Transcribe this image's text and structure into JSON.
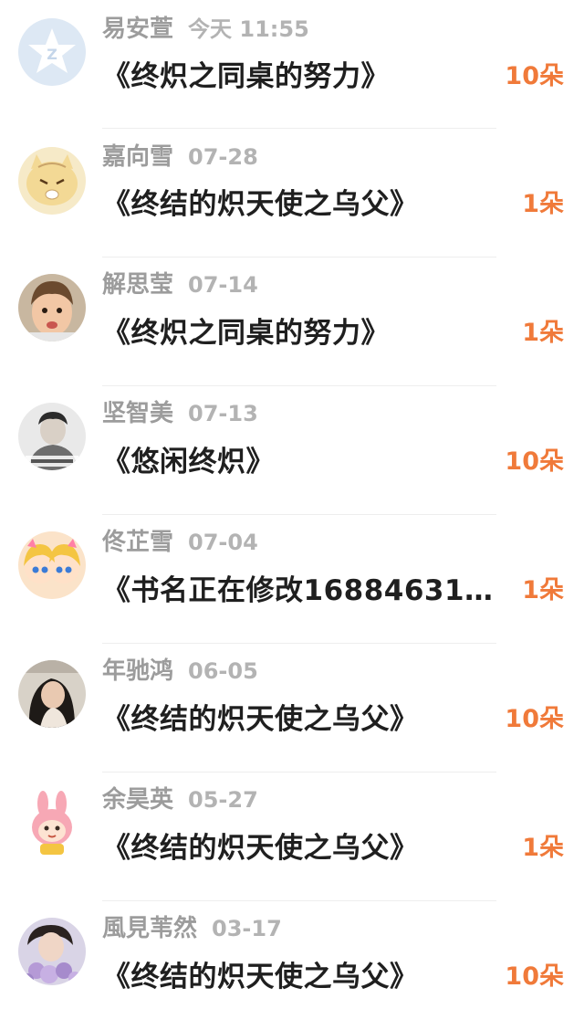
{
  "colors": {
    "count_accent": "#f07a3a",
    "name_gray": "#9c9c9c",
    "title_dark": "#1f1f1f"
  },
  "gifts": [
    {
      "name": "易安萱",
      "date": "今天 11:55",
      "title": "《终炽之同桌的努力》",
      "count": "10朵",
      "avatar": "default-star-avatar"
    },
    {
      "name": "嘉向雪",
      "date": "07-28",
      "title": "《终结的炽天使之乌父》",
      "count": "1朵",
      "avatar": "cartoon-cat-avatar"
    },
    {
      "name": "解思莹",
      "date": "07-14",
      "title": "《终炽之同桌的努力》",
      "count": "1朵",
      "avatar": "child-photo-avatar"
    },
    {
      "name": "坚智美",
      "date": "07-13",
      "title": "《悠闲终炽》",
      "count": "10朵",
      "avatar": "person-photo-avatar"
    },
    {
      "name": "佟芷雪",
      "date": "07-04",
      "title": "《书名正在修改16884631…",
      "count": "1朵",
      "avatar": "anime-twins-avatar"
    },
    {
      "name": "年驰鸿",
      "date": "06-05",
      "title": "《终结的炽天使之乌父》",
      "count": "10朵",
      "avatar": "woman-photo-avatar"
    },
    {
      "name": "余昊英",
      "date": "05-27",
      "title": "《终结的炽天使之乌父》",
      "count": "1朵",
      "avatar": "bunny-cartoon-avatar"
    },
    {
      "name": "風見苇然",
      "date": "03-17",
      "title": "《终结的炽天使之乌父》",
      "count": "10朵",
      "avatar": "flowers-photo-avatar"
    }
  ]
}
